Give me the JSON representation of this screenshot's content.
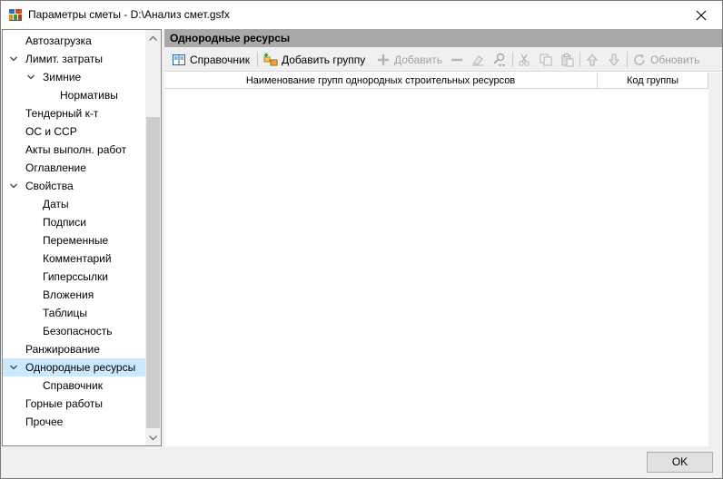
{
  "window": {
    "title": "Параметры сметы - D:\\Анализ смет.gsfx",
    "close_icon": "close-icon"
  },
  "tree": {
    "items": [
      {
        "label": "Автозагрузка",
        "level": 0,
        "expanded": null,
        "selected": false
      },
      {
        "label": "Лимит. затраты",
        "level": 0,
        "expanded": true,
        "selected": false
      },
      {
        "label": "Зимние",
        "level": 1,
        "expanded": true,
        "selected": false
      },
      {
        "label": "Нормативы",
        "level": 2,
        "expanded": null,
        "selected": false
      },
      {
        "label": "Тендерный к-т",
        "level": 0,
        "expanded": null,
        "selected": false
      },
      {
        "label": "ОС и ССР",
        "level": 0,
        "expanded": null,
        "selected": false
      },
      {
        "label": "Акты выполн. работ",
        "level": 0,
        "expanded": null,
        "selected": false
      },
      {
        "label": "Оглавление",
        "level": 0,
        "expanded": null,
        "selected": false
      },
      {
        "label": "Свойства",
        "level": 0,
        "expanded": true,
        "selected": false
      },
      {
        "label": "Даты",
        "level": 1,
        "expanded": null,
        "selected": false
      },
      {
        "label": "Подписи",
        "level": 1,
        "expanded": null,
        "selected": false
      },
      {
        "label": "Переменные",
        "level": 1,
        "expanded": null,
        "selected": false
      },
      {
        "label": "Комментарий",
        "level": 1,
        "expanded": null,
        "selected": false
      },
      {
        "label": "Гиперссылки",
        "level": 1,
        "expanded": null,
        "selected": false
      },
      {
        "label": "Вложения",
        "level": 1,
        "expanded": null,
        "selected": false
      },
      {
        "label": "Таблицы",
        "level": 1,
        "expanded": null,
        "selected": false
      },
      {
        "label": "Безопасность",
        "level": 1,
        "expanded": null,
        "selected": false
      },
      {
        "label": "Ранжирование",
        "level": 0,
        "expanded": null,
        "selected": false
      },
      {
        "label": "Однородные ресурсы",
        "level": 0,
        "expanded": true,
        "selected": true
      },
      {
        "label": "Справочник",
        "level": 1,
        "expanded": null,
        "selected": false
      },
      {
        "label": "Горные работы",
        "level": 0,
        "expanded": null,
        "selected": false
      },
      {
        "label": "Прочее",
        "level": 0,
        "expanded": null,
        "selected": false
      }
    ]
  },
  "panel": {
    "header": "Однородные ресурсы",
    "toolbar": {
      "reference_label": "Справочник",
      "add_group_label": "Добавить группу",
      "add_label": "Добавить",
      "refresh_label": "Обновить"
    },
    "columns": [
      "Наименование групп однородных строительных ресурсов",
      "Код группы"
    ]
  },
  "footer": {
    "ok_label": "OK"
  },
  "colors": {
    "selected_bg": "#cce8ff",
    "panel_header_bg": "#a9a9a9",
    "window_bg": "#f0f0f0"
  }
}
